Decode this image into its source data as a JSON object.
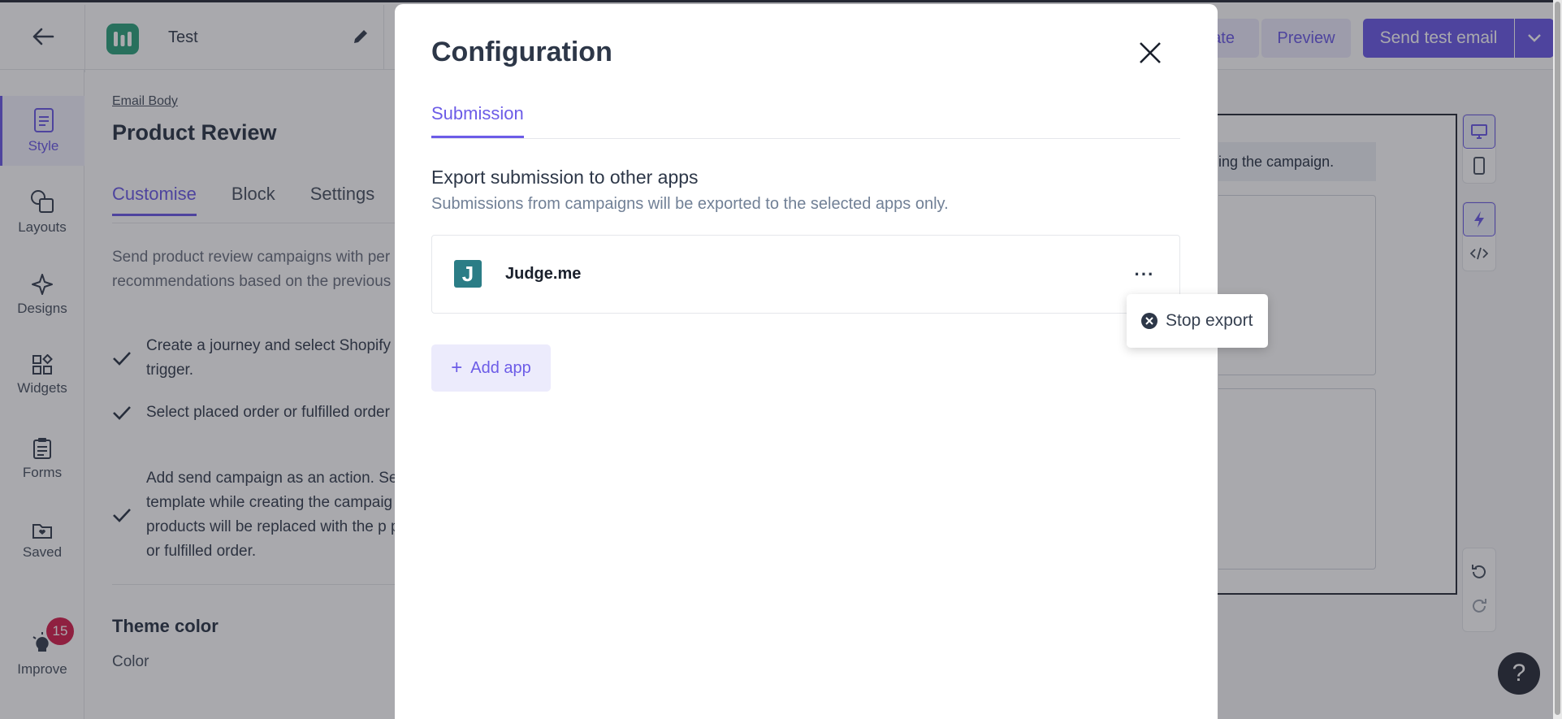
{
  "topbar": {
    "app_name": "Test",
    "partial_button": "ate",
    "preview_label": "Preview",
    "send_test_label": "Send test email"
  },
  "leftnav": {
    "items": [
      {
        "label": "Style",
        "icon": "style-icon"
      },
      {
        "label": "Layouts",
        "icon": "layouts-icon"
      },
      {
        "label": "Designs",
        "icon": "sparkle-icon"
      },
      {
        "label": "Widgets",
        "icon": "widgets-icon"
      },
      {
        "label": "Forms",
        "icon": "clipboard-icon"
      },
      {
        "label": "Saved",
        "icon": "folder-icon"
      },
      {
        "label": "Improve",
        "icon": "bulb-icon"
      }
    ],
    "improve_badge": "15"
  },
  "panel": {
    "breadcrumb": "Email Body",
    "title": "Product Review",
    "tabs": [
      "Customise",
      "Block",
      "Settings"
    ],
    "description": "Send product review campaigns with per product recommendations based on the previous orders.",
    "checks": [
      "Create a journey and select Shopify the trigger.",
      "Select placed order or fulfilled order event.",
      "Add send campaign as an action. Se template while creating the campaig products will be replaced with the p placed or fulfilled order."
    ],
    "theme_title": "Theme color",
    "color_label": "Color"
  },
  "canvas": {
    "notice_text": "ing the campaign."
  },
  "modal": {
    "title": "Configuration",
    "tab": "Submission",
    "heading": "Export submission to other apps",
    "subheading": "Submissions from campaigns will be exported to the selected apps only.",
    "app": {
      "name": "Judge.me",
      "logo_letter": "J",
      "more": "···"
    },
    "add_app_label": "Add app",
    "dropdown": {
      "stop_export_label": "Stop export"
    }
  },
  "colors": {
    "accent": "#6c5ce7",
    "accent_light": "#ecebfc",
    "badge": "#d6234f",
    "judgeme_logo": "#2b7d86"
  }
}
